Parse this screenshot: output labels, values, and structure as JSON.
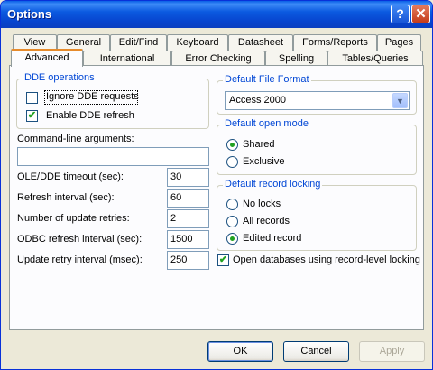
{
  "window": {
    "title": "Options",
    "help": "?",
    "close": "✕"
  },
  "tabs_row1": [
    "View",
    "General",
    "Edit/Find",
    "Keyboard",
    "Datasheet",
    "Forms/Reports",
    "Pages"
  ],
  "tabs_row2": [
    "Advanced",
    "International",
    "Error Checking",
    "Spelling",
    "Tables/Queries"
  ],
  "dde": {
    "group_label": "DDE operations",
    "ignore": {
      "label": "Ignore DDE requests",
      "checked": false
    },
    "enable": {
      "label": "Enable DDE refresh",
      "checked": true
    }
  },
  "cmdline": {
    "label": "Command-line arguments:",
    "value": ""
  },
  "settings": [
    {
      "label": "OLE/DDE timeout (sec):",
      "value": "30"
    },
    {
      "label": "Refresh interval (sec):",
      "value": "60"
    },
    {
      "label": "Number of update retries:",
      "value": "2"
    },
    {
      "label": "ODBC refresh interval (sec):",
      "value": "1500"
    },
    {
      "label": "Update retry interval (msec):",
      "value": "250"
    }
  ],
  "file_format": {
    "group_label": "Default File Format",
    "selected": "Access 2000"
  },
  "open_mode": {
    "group_label": "Default open mode",
    "options": [
      {
        "label": "Shared",
        "selected": true
      },
      {
        "label": "Exclusive",
        "selected": false
      }
    ]
  },
  "record_locking": {
    "group_label": "Default record locking",
    "options": [
      {
        "label": "No locks",
        "selected": false
      },
      {
        "label": "All records",
        "selected": false
      },
      {
        "label": "Edited record",
        "selected": true
      }
    ]
  },
  "record_level": {
    "label": "Open databases using record-level locking",
    "checked": true
  },
  "buttons": {
    "ok": "OK",
    "cancel": "Cancel",
    "apply": "Apply"
  },
  "check_glyph": "✔",
  "dropdown_glyph": "▼"
}
